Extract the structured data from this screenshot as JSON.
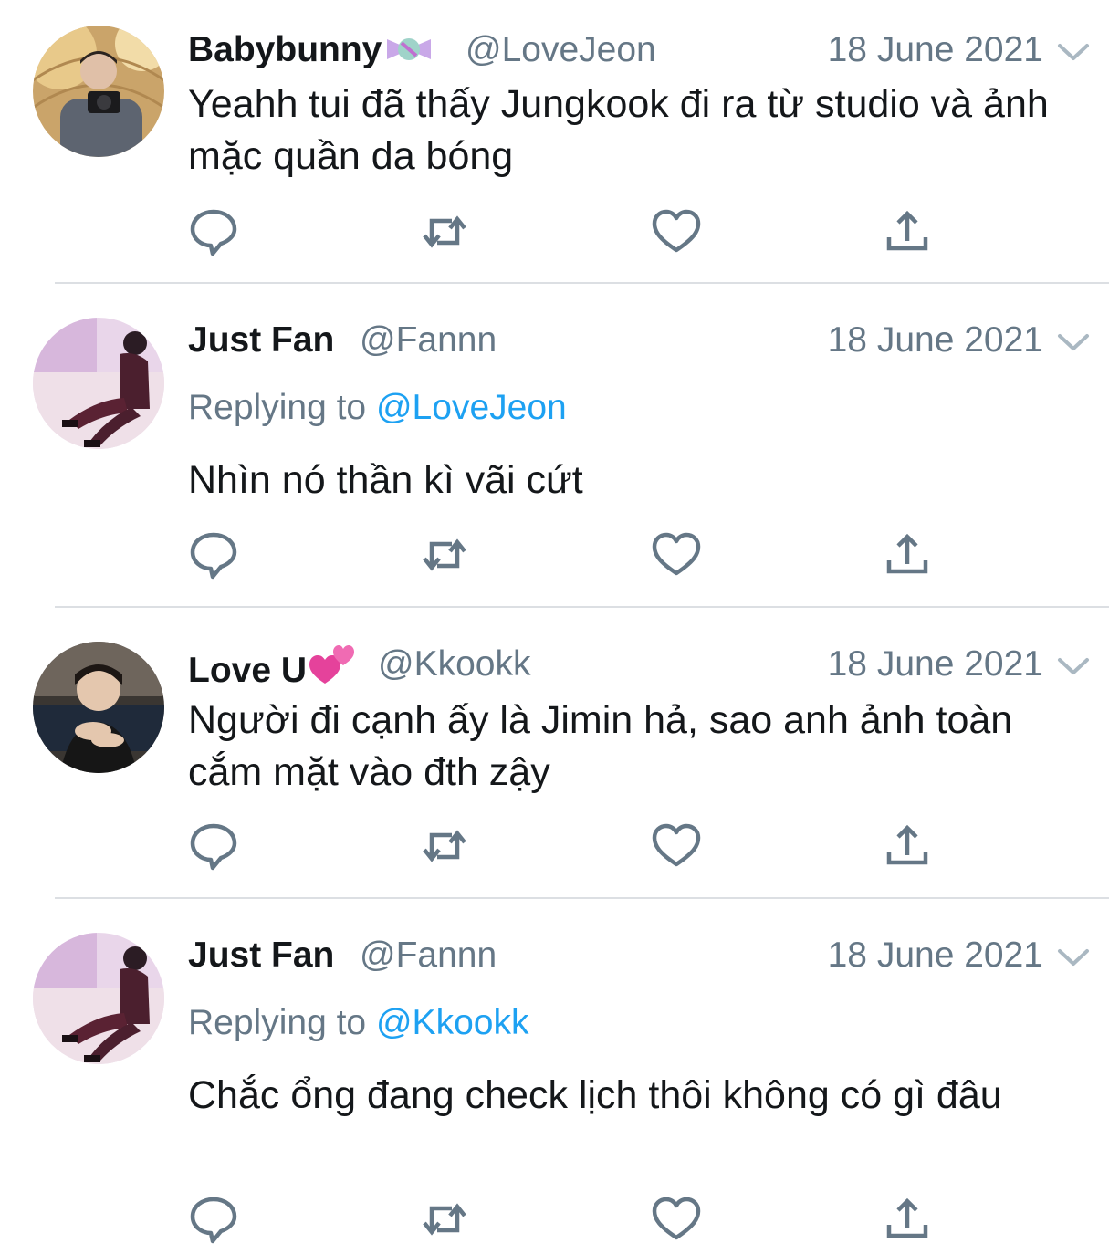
{
  "tweets": [
    {
      "display_name": "Babybunny",
      "name_emoji": "candy",
      "handle": "@LoveJeon",
      "date": "18 June 2021",
      "replying_label": "",
      "replying_to": "",
      "text": "Yeahh tui đã thấy Jungkook đi ra từ studio và ảnh mặc quần da bóng",
      "avatar": "avatar-photo-camera"
    },
    {
      "display_name": "Just Fan",
      "name_emoji": "",
      "handle": "@Fannn",
      "date": "18 June 2021",
      "replying_label": "Replying to",
      "replying_to": "@LoveJeon",
      "text": "Nhìn nó thần kì vãi cứt",
      "avatar": "avatar-photo-seated"
    },
    {
      "display_name": "Love U",
      "name_emoji": "two-hearts",
      "handle": "@Kkookk",
      "date": "18 June 2021",
      "replying_label": "",
      "replying_to": "",
      "text": "Người đi cạnh ấy là Jimin hả, sao anh ảnh toàn cắm mặt vào đth zậy",
      "avatar": "avatar-photo-portrait"
    },
    {
      "display_name": "Just Fan",
      "name_emoji": "",
      "handle": "@Fannn",
      "date": "18 June 2021",
      "replying_label": "Replying to",
      "replying_to": "@Kkookk",
      "text": "Chắc ổng đang check lịch thôi không có gì đâu",
      "avatar": "avatar-photo-seated"
    }
  ],
  "action_icons": [
    "reply-icon",
    "retweet-icon",
    "like-icon",
    "share-icon"
  ],
  "colors": {
    "text": "#14171a",
    "secondary": "#657786",
    "link": "#1da1f2",
    "divider": "#dcdfe3"
  }
}
